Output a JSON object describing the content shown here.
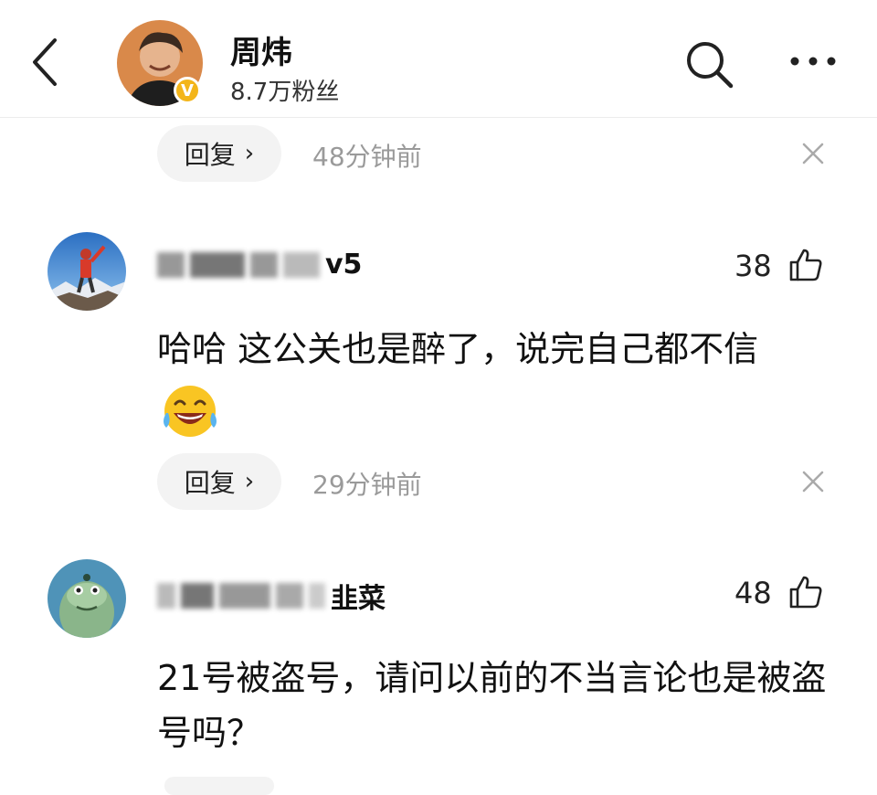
{
  "header": {
    "name": "周炜",
    "fans": "8.7万粉丝",
    "verified_mark": "V",
    "icons": [
      "back-icon",
      "search-icon",
      "more-icon"
    ]
  },
  "top_reply": {
    "reply_label": "回复",
    "time": "48分钟前"
  },
  "comments": [
    {
      "username_suffix": "v5",
      "likes": "38",
      "text": "哈哈 这公关也是醉了，说完自己都不信",
      "emoji": "laughing-tears-emoji",
      "reply_label": "回复",
      "time": "29分钟前"
    },
    {
      "username_suffix": "韭菜",
      "likes": "48",
      "text": "21号被盗号，请问以前的不当言论也是被盗号吗？"
    }
  ],
  "colors": {
    "verified": "#f3b51a",
    "muted": "#9a9a9a",
    "pill": "#f3f3f3"
  }
}
